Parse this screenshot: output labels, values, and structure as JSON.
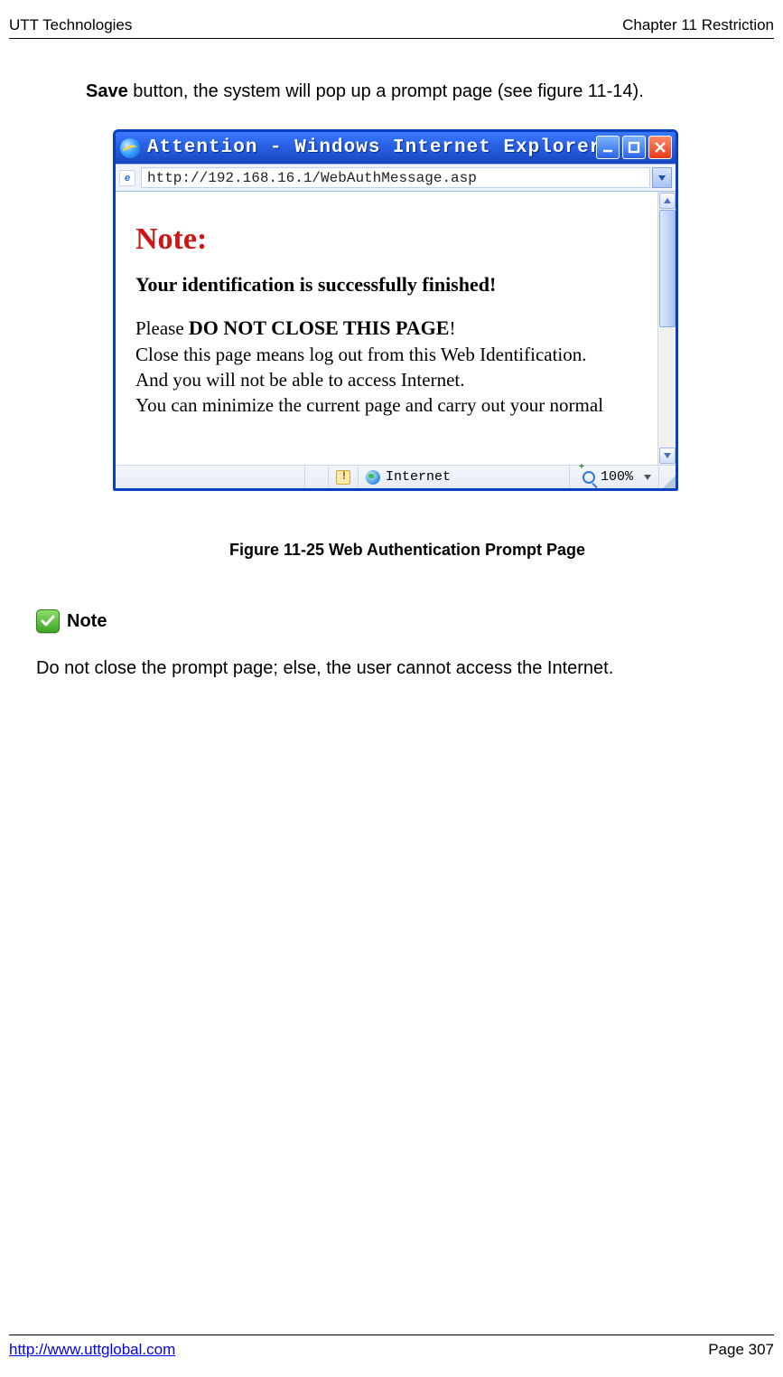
{
  "header": {
    "left": "UTT Technologies",
    "right": "Chapter 11 Restriction"
  },
  "footer": {
    "url": "http://www.uttglobal.com",
    "page": "Page 307"
  },
  "lead": {
    "bold": "Save",
    "rest": " button, the system will pop up a prompt page (see figure 11-14)."
  },
  "ie": {
    "title": "Attention - Windows Internet Explorer",
    "url": "http://192.168.16.1/WebAuthMessage.asp",
    "note_heading": "Note:",
    "success": "Your identification is successfully finished!",
    "line1_a": "Please ",
    "line1_b": "DO NOT CLOSE THIS PAGE",
    "line1_c": "!",
    "line2": "Close this page means log out from this Web Identification.",
    "line3": "And you will not be able to access Internet.",
    "line4": "You can minimize the current page and carry out your normal",
    "status_zone": "Internet",
    "zoom": "100%"
  },
  "caption": "Figure 11-25 Web Authentication Prompt Page",
  "note": {
    "label": "Note",
    "text": "Do not close the prompt page; else, the user cannot access the Internet."
  }
}
